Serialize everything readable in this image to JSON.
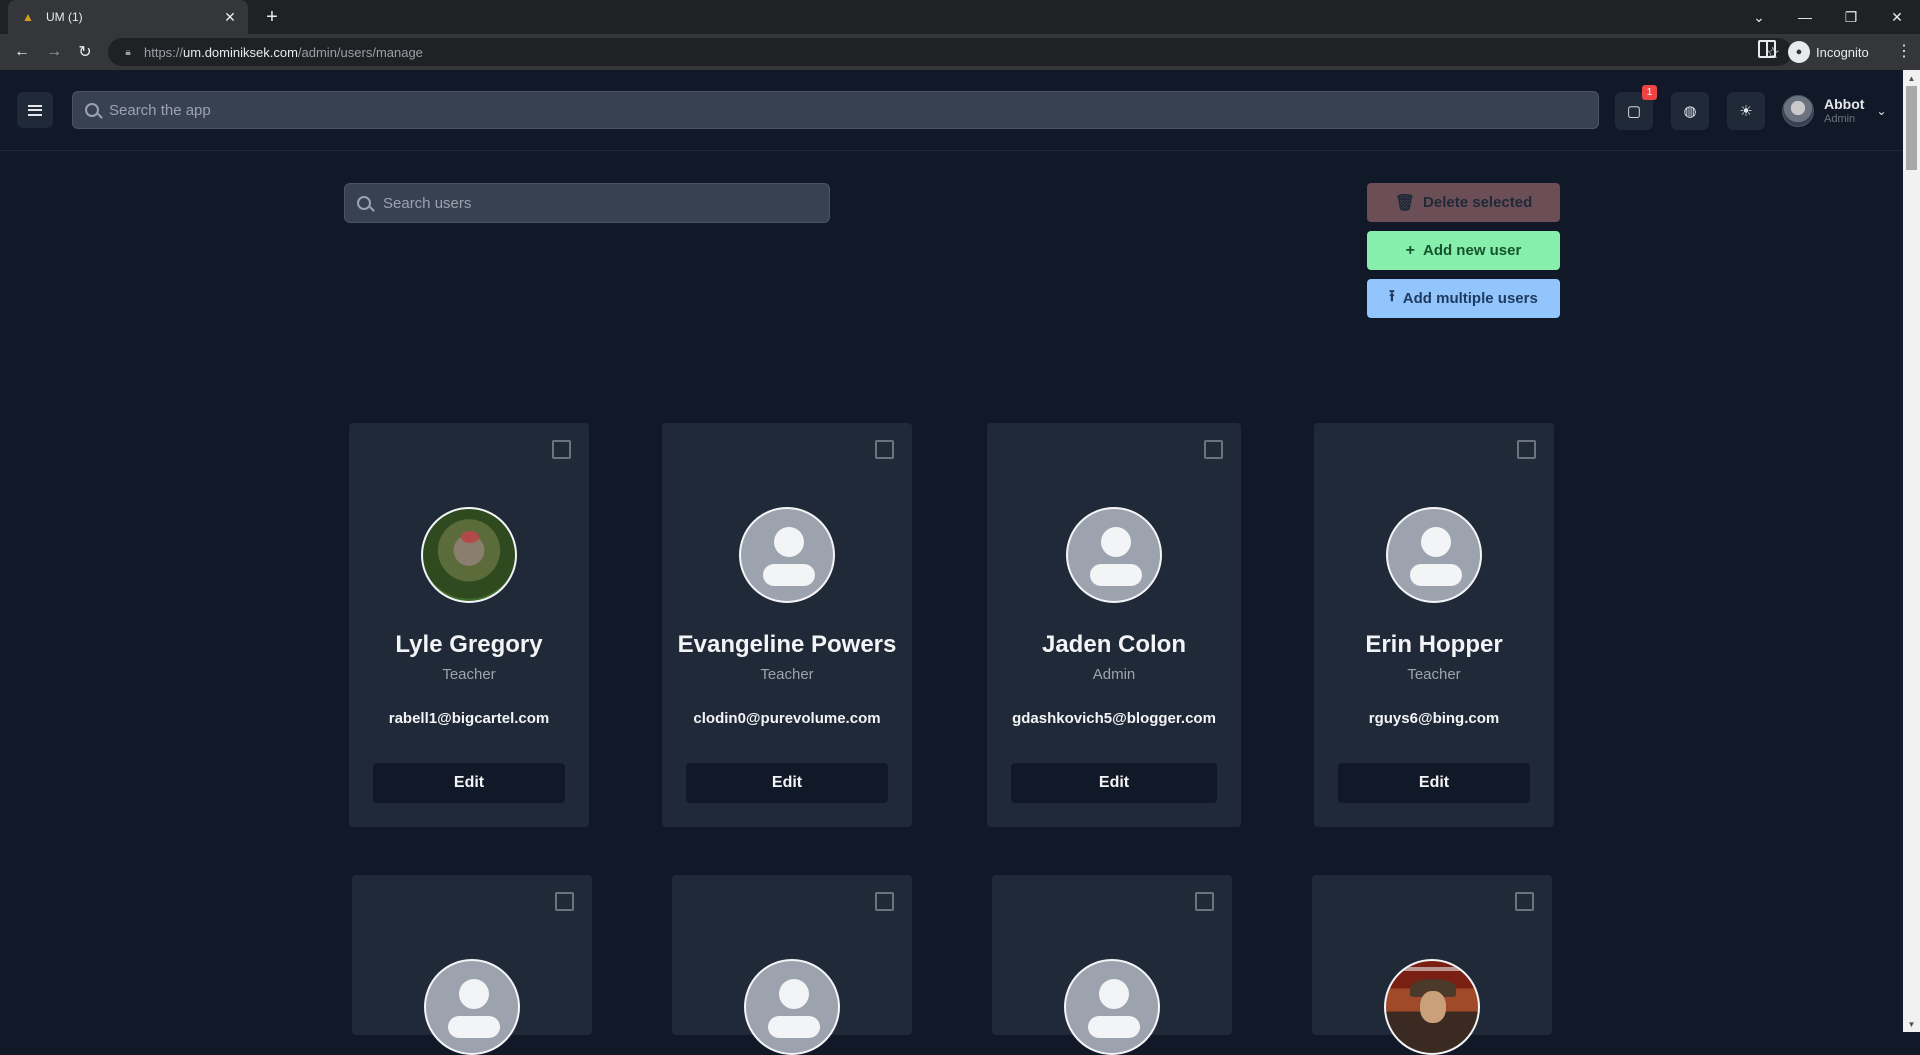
{
  "browser": {
    "tab_title": "UM (1)",
    "url_prefix": "https://",
    "url_host": "um.dominiksek.com",
    "url_path": "/admin/users/manage",
    "profile_label": "Incognito"
  },
  "header": {
    "search_placeholder": "Search the app",
    "notification_count": "1",
    "user_name": "Abbot",
    "user_role": "Admin"
  },
  "toolbar": {
    "search_placeholder": "Search users",
    "delete_label": "Delete selected",
    "add_label": "Add new user",
    "add_multiple_label": "Add multiple users"
  },
  "users": [
    {
      "name": "Lyle Gregory",
      "role": "Teacher",
      "email": "rabell1@bigcartel.com",
      "edit_label": "Edit"
    },
    {
      "name": "Evangeline Powers",
      "role": "Teacher",
      "email": "clodin0@purevolume.com",
      "edit_label": "Edit"
    },
    {
      "name": "Jaden Colon",
      "role": "Admin",
      "email": "gdashkovich5@blogger.com",
      "edit_label": "Edit"
    },
    {
      "name": "Erin Hopper",
      "role": "Teacher",
      "email": "rguys6@bing.com",
      "edit_label": "Edit"
    }
  ],
  "colors": {
    "background": "#111827",
    "card": "#1f2937",
    "delete_button": "#6b4e56",
    "add_button": "#86efac",
    "add_multiple_button": "#93c5fd"
  }
}
